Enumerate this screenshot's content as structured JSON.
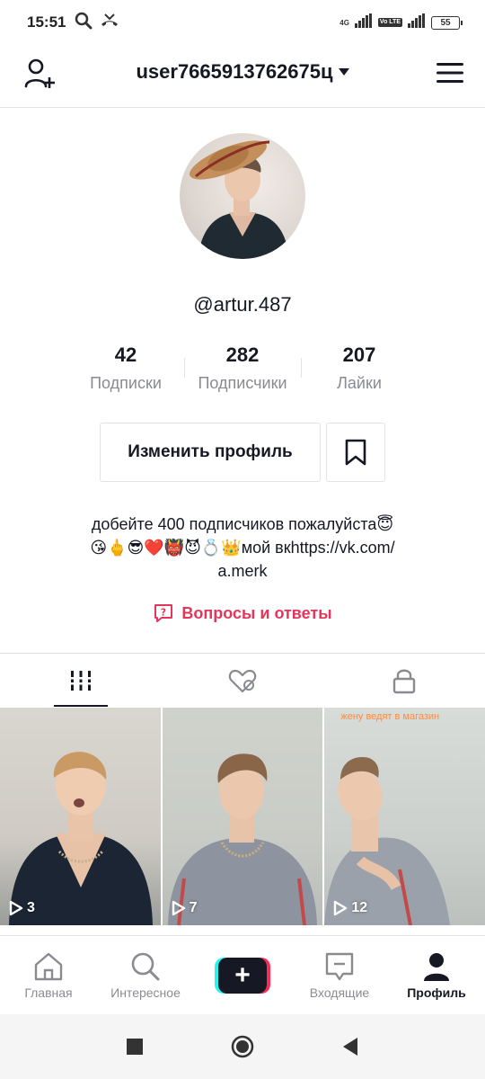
{
  "status_bar": {
    "time": "15:51",
    "network": "4G",
    "volte": "Vo LTE",
    "battery": "55"
  },
  "header": {
    "username": "user7665913762675ц"
  },
  "profile": {
    "handle": "@artur.487",
    "stats": [
      {
        "value": "42",
        "label": "Подписки"
      },
      {
        "value": "282",
        "label": "Подписчики"
      },
      {
        "value": "207",
        "label": "Лайки"
      }
    ],
    "edit_button": "Изменить профиль",
    "bio_line1": "добейте 400 подписчиков пожалуйста😇",
    "bio_line2": "😘🖕😎❤️👹😈💍👑мой вкhttps://vk.com/",
    "bio_line3": "a.merk",
    "qa_link": "Вопросы и ответы"
  },
  "tabs": [
    "videos-grid-icon",
    "liked-heart-icon",
    "private-lock-icon"
  ],
  "videos": [
    {
      "views": "3",
      "caption": ""
    },
    {
      "views": "7",
      "caption": ""
    },
    {
      "views": "12",
      "caption": "жену ведят в магазин"
    }
  ],
  "bottom_nav": [
    {
      "label": "Главная",
      "icon": "home-icon"
    },
    {
      "label": "Интересное",
      "icon": "search-icon"
    },
    {
      "label": "",
      "icon": "create-icon"
    },
    {
      "label": "Входящие",
      "icon": "inbox-icon"
    },
    {
      "label": "Профиль",
      "icon": "profile-icon"
    }
  ],
  "colors": {
    "accent": "#e2375b",
    "text": "#161823",
    "muted": "#8a8b91"
  }
}
